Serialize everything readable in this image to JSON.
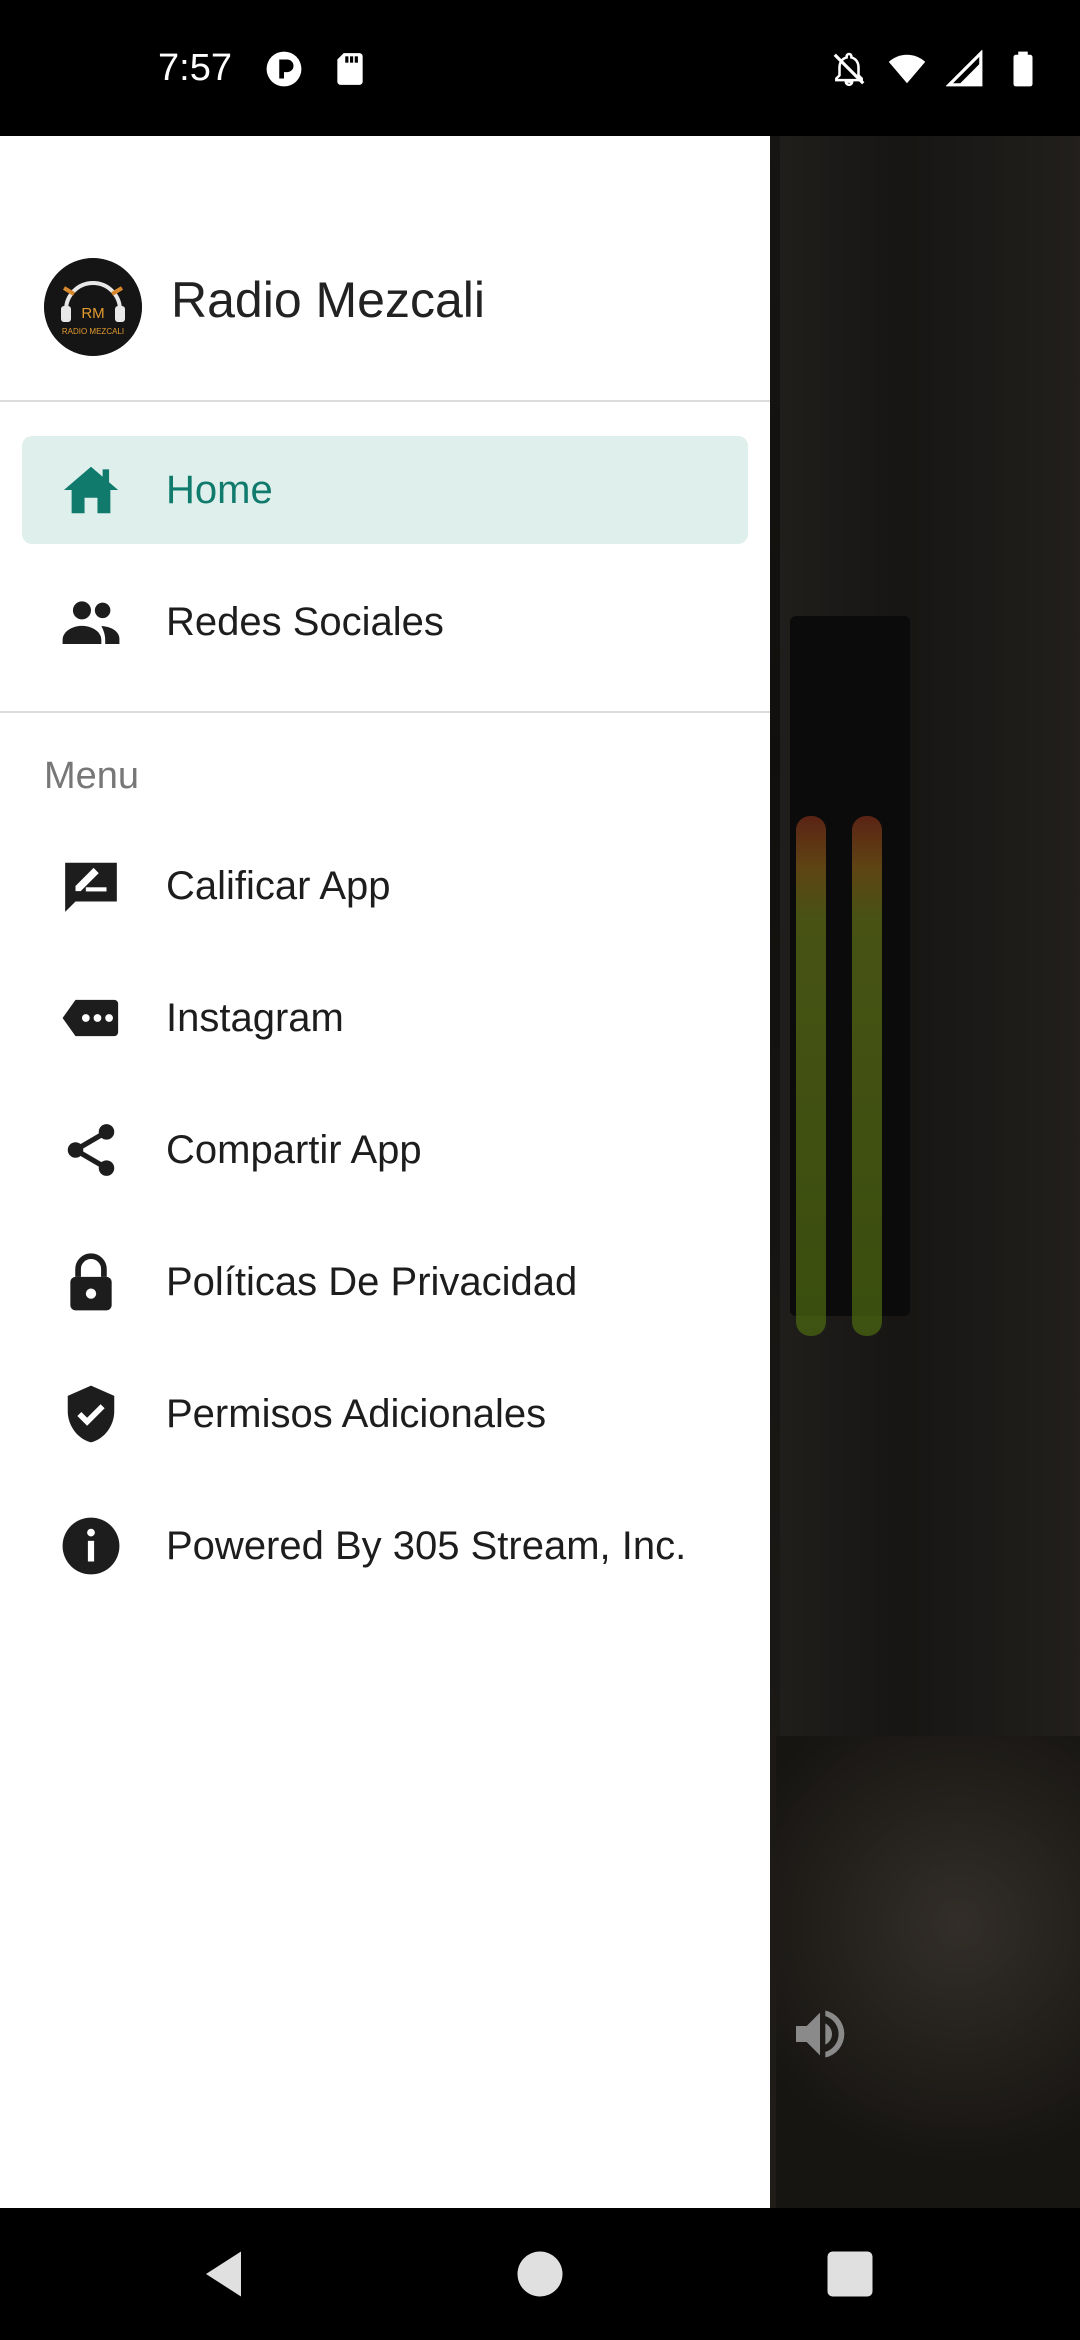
{
  "status_bar": {
    "time": "7:57",
    "left_icons": [
      "notification-dot-icon",
      "sd-card-icon"
    ],
    "right_icons": [
      "bell-off-icon",
      "wifi-icon",
      "signal-icon",
      "battery-icon"
    ]
  },
  "drawer": {
    "app_title": "Radio Mezcali",
    "logo_text": "RM",
    "logo_subtext": "RADIO MEZCALI",
    "primary_items": [
      {
        "label": "Home",
        "icon": "home-icon",
        "active": true
      },
      {
        "label": "Redes Sociales",
        "icon": "people-icon",
        "active": false
      }
    ],
    "section_label": "Menu",
    "menu_items": [
      {
        "label": "Calificar App",
        "icon": "rate-review-icon"
      },
      {
        "label": "Instagram",
        "icon": "chat-bubble-icon"
      },
      {
        "label": "Compartir App",
        "icon": "share-icon"
      },
      {
        "label": "Políticas De Privacidad",
        "icon": "lock-icon"
      },
      {
        "label": "Permisos Adicionales",
        "icon": "shield-check-icon"
      },
      {
        "label": "Powered By 305 Stream, Inc.",
        "icon": "info-icon"
      }
    ]
  },
  "colors": {
    "accent": "#107a6c",
    "active_bg": "#dff0ec"
  }
}
